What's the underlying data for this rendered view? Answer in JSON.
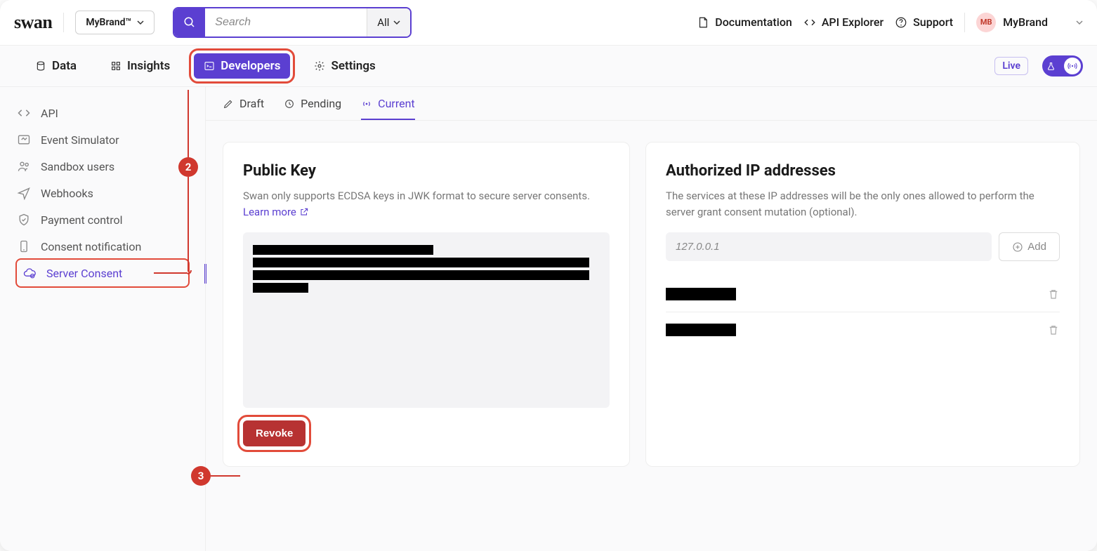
{
  "header": {
    "logo": "swan",
    "brand_button": "MyBrand™",
    "search_placeholder": "Search",
    "search_filter": "All",
    "links": {
      "documentation": "Documentation",
      "api_explorer": "API Explorer",
      "support": "Support"
    },
    "account": {
      "name": "MyBrand",
      "initials": "MB"
    }
  },
  "nav": {
    "data": "Data",
    "insights": "Insights",
    "developers": "Developers",
    "settings": "Settings",
    "live_badge": "Live"
  },
  "sidebar": {
    "items": [
      {
        "label": "API"
      },
      {
        "label": "Event Simulator"
      },
      {
        "label": "Sandbox users"
      },
      {
        "label": "Webhooks"
      },
      {
        "label": "Payment control"
      },
      {
        "label": "Consent notification"
      },
      {
        "label": "Server Consent"
      }
    ]
  },
  "subtabs": {
    "draft": "Draft",
    "pending": "Pending",
    "current": "Current"
  },
  "cards": {
    "public_key": {
      "title": "Public Key",
      "desc_prefix": "Swan only supports ECDSA keys in JWK format to secure server consents. ",
      "learn_more": "Learn more",
      "revoke": "Revoke"
    },
    "authorized_ips": {
      "title": "Authorized IP addresses",
      "desc": "The services at these IP addresses will be the only ones allowed to perform the server grant consent mutation (optional).",
      "ip_placeholder": "127.0.0.1",
      "add": "Add"
    }
  },
  "annotations": {
    "step2": "2",
    "step3": "3"
  }
}
